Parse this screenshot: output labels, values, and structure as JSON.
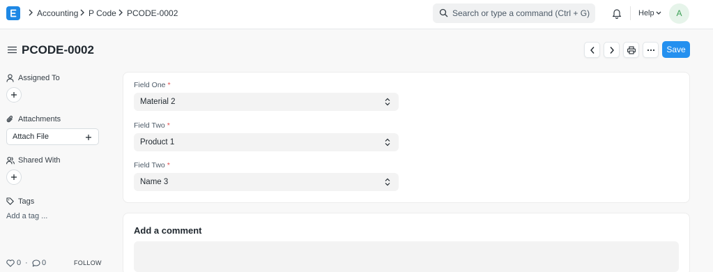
{
  "navbar": {
    "logo_letter": "E",
    "breadcrumbs": [
      "Accounting",
      "P Code",
      "PCODE-0002"
    ],
    "search_placeholder": "Search or type a command (Ctrl + G)",
    "help_label": "Help",
    "avatar_initial": "A"
  },
  "page": {
    "title": "PCODE-0002",
    "save_label": "Save"
  },
  "sidebar": {
    "assigned_to_label": "Assigned To",
    "attachments_label": "Attachments",
    "attach_file_label": "Attach File",
    "shared_with_label": "Shared With",
    "tags_label": "Tags",
    "add_tag_label": "Add a tag ...",
    "likes_count": "0",
    "separator": "·",
    "comments_count": "0",
    "follow_label": "FOLLOW"
  },
  "form": {
    "fields": [
      {
        "label": "Field One",
        "required": "*",
        "value": "Material 2"
      },
      {
        "label": "Field Two",
        "required": "*",
        "value": "Product 1"
      },
      {
        "label": "Field Two",
        "required": "*",
        "value": "Name 3"
      }
    ]
  },
  "comments": {
    "title": "Add a comment"
  },
  "colors": {
    "primary": "#2490ef",
    "logo": "#1e88e5",
    "required": "#e24c4c",
    "avatar_bg": "#e6f4ea",
    "avatar_fg": "#3ba055"
  },
  "icons": {
    "logo": "frappe-logo-icon",
    "breadcrumb_separator": "chevron-right-icon",
    "search": "search-icon",
    "notifications": "bell-icon",
    "help_dropdown": "chevron-down-icon",
    "sidebar_toggle": "hamburger-icon",
    "prev": "chevron-left-icon",
    "next": "chevron-right-icon",
    "print": "printer-icon",
    "more": "ellipsis-icon",
    "assigned": "user-icon",
    "attachments": "paperclip-icon",
    "shared": "users-icon",
    "tags": "tag-icon",
    "add": "plus-icon",
    "like": "heart-icon",
    "comment": "comment-icon",
    "select": "select-arrows-icon"
  }
}
